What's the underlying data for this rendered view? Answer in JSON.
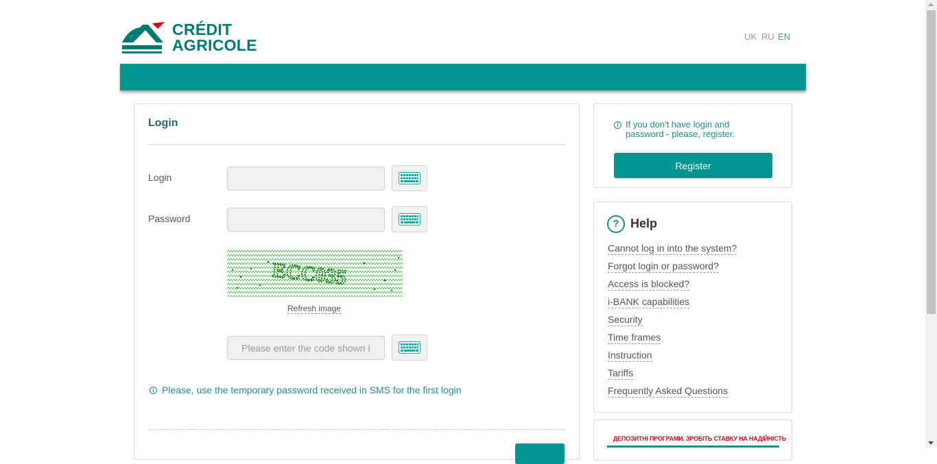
{
  "header": {
    "brand_line1": "CRÉDIT",
    "brand_line2": "AGRICOLE",
    "languages": [
      {
        "code": "UK",
        "active": false
      },
      {
        "code": "RU",
        "active": false
      },
      {
        "code": "EN",
        "active": true
      }
    ]
  },
  "colors": {
    "accent": "#00968f",
    "brand_green": "#007a73",
    "brand_red": "#e2001a",
    "link_teal": "#1f8f87"
  },
  "login": {
    "title": "Login",
    "login_label": "Login",
    "login_value": "",
    "password_label": "Password",
    "password_value": "",
    "captcha_text": "ECC035",
    "refresh_label": "Refresh image",
    "code_placeholder": "Please enter the code shown in the image",
    "code_value": "",
    "note": "Please, use the temporary password received in SMS for the first login",
    "keyboard_icon": "keyboard-icon",
    "info_icon": "info-icon"
  },
  "register": {
    "note": "If you don't have login and password - please, register.",
    "button_label": "Register"
  },
  "help": {
    "title": "Help",
    "links": [
      "Cannot log in into the system?",
      "Forgot login or password?",
      "Access is blocked?",
      "i-BANK capabilities",
      "Security",
      "Time frames",
      "Instruction",
      "Tariffs",
      "Frequently Asked Questions"
    ]
  },
  "banner": {
    "text": "ДЕПОЗИТНІ ПРОГРАМИ. ЗРОБІТЬ СТАВКУ НА НАДІЙНІСТЬ"
  }
}
